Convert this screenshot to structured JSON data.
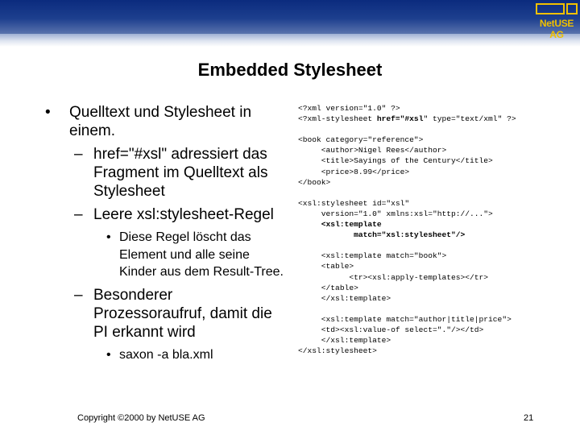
{
  "header": {
    "logo_text": "NetUSE AG",
    "colors": {
      "bar": "#1d3f8e",
      "logo": "#f0c000"
    }
  },
  "slide": {
    "title": "Embedded Stylesheet"
  },
  "bullets": [
    {
      "level": 1,
      "marker": "•",
      "text": "Quelltext und Stylesheet in einem."
    },
    {
      "level": 2,
      "marker": "–",
      "text": "href=\"#xsl\" adressiert das Fragment im Quelltext als Stylesheet"
    },
    {
      "level": 2,
      "marker": "–",
      "text": "Leere xsl:stylesheet-Regel"
    },
    {
      "level": 3,
      "marker": "•",
      "text": "Diese Regel löscht das Element und alle seine Kinder aus dem Result-Tree."
    },
    {
      "level": 2,
      "marker": "–",
      "text": "Besonderer Prozessoraufruf, damit die PI erkannt wird"
    },
    {
      "level": 3,
      "marker": "•",
      "text": "saxon -a bla.xml"
    }
  ],
  "code": {
    "lines": [
      {
        "segments": [
          {
            "text": "<?xml version=\"1.0\" ?>"
          }
        ]
      },
      {
        "segments": [
          {
            "text": "<?xml-stylesheet "
          },
          {
            "text": "href=\"#xsl",
            "bold": true
          },
          {
            "text": "\" type=\"text/xml\" ?>"
          }
        ]
      },
      {
        "segments": [
          {
            "text": ""
          }
        ]
      },
      {
        "segments": [
          {
            "text": "<book category=\"reference\">"
          }
        ]
      },
      {
        "segments": [
          {
            "text": "     <author>Nigel Rees</author>"
          }
        ]
      },
      {
        "segments": [
          {
            "text": "     <title>Sayings of the Century</title>"
          }
        ]
      },
      {
        "segments": [
          {
            "text": "     <price>8.99</price>"
          }
        ]
      },
      {
        "segments": [
          {
            "text": "</book>"
          }
        ]
      },
      {
        "segments": [
          {
            "text": ""
          }
        ]
      },
      {
        "segments": [
          {
            "text": "<xsl:stylesheet id=\"xsl\""
          }
        ]
      },
      {
        "segments": [
          {
            "text": "     version=\"1.0\" xmlns:xsl=\"http://...\">"
          }
        ]
      },
      {
        "segments": [
          {
            "text": "     "
          },
          {
            "text": "<xsl:template",
            "bold": true
          }
        ]
      },
      {
        "segments": [
          {
            "text": "            "
          },
          {
            "text": "match=\"xsl:stylesheet\"/>",
            "bold": true
          }
        ]
      },
      {
        "segments": [
          {
            "text": ""
          }
        ]
      },
      {
        "segments": [
          {
            "text": "     <xsl:template match=\"book\">"
          }
        ]
      },
      {
        "segments": [
          {
            "text": "     <table>"
          }
        ]
      },
      {
        "segments": [
          {
            "text": "           <tr><xsl:apply-templates></tr>"
          }
        ]
      },
      {
        "segments": [
          {
            "text": "     </table>"
          }
        ]
      },
      {
        "segments": [
          {
            "text": "     </xsl:template>"
          }
        ]
      },
      {
        "segments": [
          {
            "text": ""
          }
        ]
      },
      {
        "segments": [
          {
            "text": "     <xsl:template match=\"author|title|price\">"
          }
        ]
      },
      {
        "segments": [
          {
            "text": "     <td><xsl:value-of select=\".\"/></td>"
          }
        ]
      },
      {
        "segments": [
          {
            "text": "     </xsl:template>"
          }
        ]
      },
      {
        "segments": [
          {
            "text": "</xsl:stylesheet>"
          }
        ]
      }
    ]
  },
  "footer": {
    "copyright": "Copyright ©2000 by NetUSE AG",
    "page_number": "21"
  }
}
